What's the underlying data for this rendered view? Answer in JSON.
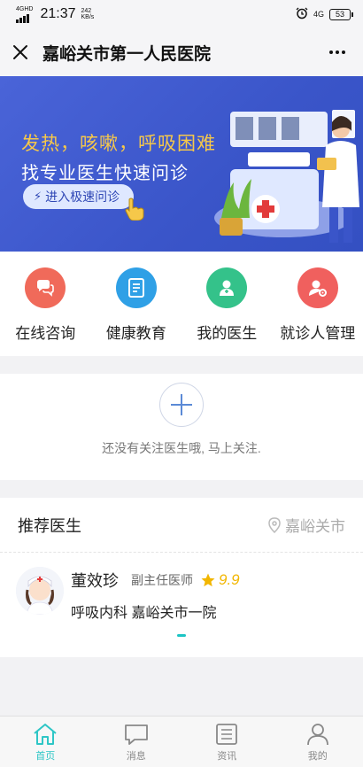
{
  "status": {
    "network": "4GHD",
    "time": "21:37",
    "speed_value": "242",
    "speed_unit": "KB/s",
    "net_type": "4G",
    "battery": "53"
  },
  "nav": {
    "title": "嘉峪关市第一人民医院"
  },
  "banner": {
    "line1": "发热，咳嗽，呼吸困难",
    "line2": "找专业医生快速问诊",
    "button": "进入极速问诊"
  },
  "quick": [
    {
      "label": "在线咨询",
      "icon": "chat-icon",
      "color": "#f06a5a"
    },
    {
      "label": "健康教育",
      "icon": "book-icon",
      "color": "#2fa0e6"
    },
    {
      "label": "我的医生",
      "icon": "doctor-icon",
      "color": "#34c28a"
    },
    {
      "label": "就诊人管理",
      "icon": "patient-settings-icon",
      "color": "#f0605e"
    }
  ],
  "follow": {
    "empty_text": "还没有关注医生哦, 马上关注."
  },
  "recommend": {
    "title": "推荐医生",
    "city": "嘉峪关市",
    "doctors": [
      {
        "name": "董效珍",
        "level": "副主任医师",
        "score": "9.9",
        "dept": "呼吸内科",
        "hospital": "嘉峪关市一院"
      }
    ]
  },
  "tabs": [
    {
      "label": "首页",
      "icon": "home-icon",
      "active": true
    },
    {
      "label": "消息",
      "icon": "message-icon",
      "active": false
    },
    {
      "label": "资讯",
      "icon": "news-icon",
      "active": false
    },
    {
      "label": "我的",
      "icon": "profile-icon",
      "active": false
    }
  ],
  "colors": {
    "accent": "#2ec6c6",
    "banner_bg": "#4a64d8",
    "banner_highlight": "#f6c84a",
    "star": "#f2b600"
  }
}
